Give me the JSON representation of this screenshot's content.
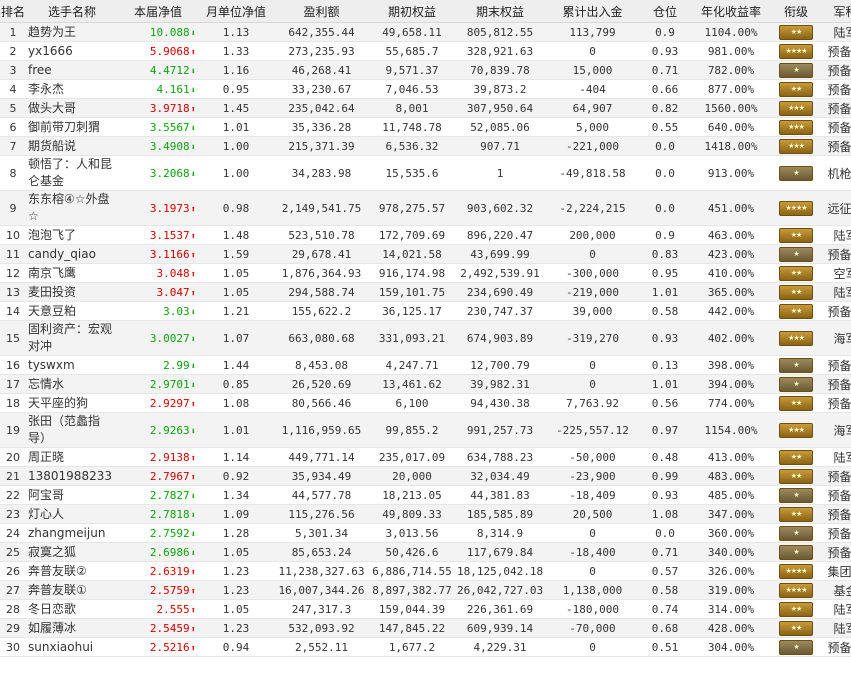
{
  "headers": [
    "排名",
    "选手名称",
    "本届净值",
    "月单位净值",
    "盈利额",
    "期初权益",
    "期末权益",
    "累计出入金",
    "仓位",
    "年化收益率",
    "衔级",
    "军种"
  ],
  "rows": [
    {
      "rank": "1",
      "name": "趋势为王",
      "nav": "10.088",
      "dir": "down",
      "mnav": "1.13",
      "profit": "642,355.44",
      "start": "49,658.11",
      "end": "805,812.55",
      "flow": "113,799",
      "pos": "0.9",
      "annual": "1104.00%",
      "badge": "★★",
      "army": "陆军"
    },
    {
      "rank": "2",
      "name": "yx1666",
      "nav": "5.9068",
      "dir": "up",
      "mnav": "1.33",
      "profit": "273,235.93",
      "start": "55,685.7",
      "end": "328,921.63",
      "flow": "0",
      "pos": "0.93",
      "annual": "981.00%",
      "badge": "★★★★",
      "army": "预备役"
    },
    {
      "rank": "3",
      "name": "free",
      "nav": "4.4712",
      "dir": "down",
      "mnav": "1.16",
      "profit": "46,268.41",
      "start": "9,571.37",
      "end": "70,839.78",
      "flow": "15,000",
      "pos": "0.71",
      "annual": "782.00%",
      "badge": "★",
      "army": "预备役"
    },
    {
      "rank": "4",
      "name": "李永杰",
      "nav": "4.161",
      "dir": "down",
      "mnav": "0.95",
      "profit": "33,230.67",
      "start": "7,046.53",
      "end": "39,873.2",
      "flow": "-404",
      "pos": "0.66",
      "annual": "877.00%",
      "badge": "★★",
      "army": "预备役"
    },
    {
      "rank": "5",
      "name": "做头大哥",
      "nav": "3.9718",
      "dir": "up",
      "mnav": "1.45",
      "profit": "235,042.64",
      "start": "8,001",
      "end": "307,950.64",
      "flow": "64,907",
      "pos": "0.82",
      "annual": "1560.00%",
      "badge": "★★★",
      "army": "预备役"
    },
    {
      "rank": "6",
      "name": "御前带刀刺猬",
      "nav": "3.5567",
      "dir": "down",
      "mnav": "1.01",
      "profit": "35,336.28",
      "start": "11,748.78",
      "end": "52,085.06",
      "flow": "5,000",
      "pos": "0.55",
      "annual": "640.00%",
      "badge": "★★★",
      "army": "预备役"
    },
    {
      "rank": "7",
      "name": "期货船说",
      "nav": "3.4908",
      "dir": "down",
      "mnav": "1.00",
      "profit": "215,371.39",
      "start": "6,536.32",
      "end": "907.71",
      "flow": "-221,000",
      "pos": "0.0",
      "annual": "1418.00%",
      "badge": "★★★",
      "army": "预备役"
    },
    {
      "rank": "8",
      "name": "顿悟了：人和昆仑基金",
      "nav": "3.2068",
      "dir": "down",
      "mnav": "1.00",
      "profit": "34,283.98",
      "start": "15,535.6",
      "end": "1",
      "flow": "-49,818.58",
      "pos": "0.0",
      "annual": "913.00%",
      "badge": "★",
      "army": "机枪手"
    },
    {
      "rank": "9",
      "name": "东东榕④☆外盘☆",
      "nav": "3.1973",
      "dir": "up",
      "mnav": "0.98",
      "profit": "2,149,541.75",
      "start": "978,275.57",
      "end": "903,602.32",
      "flow": "-2,224,215",
      "pos": "0.0",
      "annual": "451.00%",
      "badge": "★★★★",
      "army": "远征军"
    },
    {
      "rank": "10",
      "name": "泡泡飞了",
      "nav": "3.1537",
      "dir": "up",
      "mnav": "1.48",
      "profit": "523,510.78",
      "start": "172,709.69",
      "end": "896,220.47",
      "flow": "200,000",
      "pos": "0.9",
      "annual": "463.00%",
      "badge": "★★",
      "army": "陆军"
    },
    {
      "rank": "11",
      "name": "candy_qiao",
      "nav": "3.1166",
      "dir": "up",
      "mnav": "1.59",
      "profit": "29,678.41",
      "start": "14,021.58",
      "end": "43,699.99",
      "flow": "0",
      "pos": "0.83",
      "annual": "423.00%",
      "badge": "★",
      "army": "预备役"
    },
    {
      "rank": "12",
      "name": "南京飞鹰",
      "nav": "3.048",
      "dir": "up",
      "mnav": "1.05",
      "profit": "1,876,364.93",
      "start": "916,174.98",
      "end": "2,492,539.91",
      "flow": "-300,000",
      "pos": "0.95",
      "annual": "410.00%",
      "badge": "★★",
      "army": "空军"
    },
    {
      "rank": "13",
      "name": "麦田投资",
      "nav": "3.047",
      "dir": "up",
      "mnav": "1.05",
      "profit": "294,588.74",
      "start": "159,101.75",
      "end": "234,690.49",
      "flow": "-219,000",
      "pos": "1.01",
      "annual": "365.00%",
      "badge": "★★",
      "army": "陆军"
    },
    {
      "rank": "14",
      "name": "天意豆粕",
      "nav": "3.03",
      "dir": "down",
      "mnav": "1.21",
      "profit": "155,622.2",
      "start": "36,125.17",
      "end": "230,747.37",
      "flow": "39,000",
      "pos": "0.58",
      "annual": "442.00%",
      "badge": "★★",
      "army": "预备役"
    },
    {
      "rank": "15",
      "name": "固利资产：宏观对冲",
      "nav": "3.0027",
      "dir": "down",
      "mnav": "1.07",
      "profit": "663,080.68",
      "start": "331,093.21",
      "end": "674,903.89",
      "flow": "-319,270",
      "pos": "0.93",
      "annual": "402.00%",
      "badge": "★★★",
      "army": "海军"
    },
    {
      "rank": "16",
      "name": "tyswxm",
      "nav": "2.99",
      "dir": "down",
      "mnav": "1.44",
      "profit": "8,453.08",
      "start": "4,247.71",
      "end": "12,700.79",
      "flow": "0",
      "pos": "0.13",
      "annual": "398.00%",
      "badge": "★",
      "army": "预备役"
    },
    {
      "rank": "17",
      "name": "忘情水",
      "nav": "2.9701",
      "dir": "down",
      "mnav": "0.85",
      "profit": "26,520.69",
      "start": "13,461.62",
      "end": "39,982.31",
      "flow": "0",
      "pos": "1.01",
      "annual": "394.00%",
      "badge": "★",
      "army": "预备役"
    },
    {
      "rank": "18",
      "name": "天平座的狗",
      "nav": "2.9297",
      "dir": "up",
      "mnav": "1.08",
      "profit": "80,566.46",
      "start": "6,100",
      "end": "94,430.38",
      "flow": "7,763.92",
      "pos": "0.56",
      "annual": "774.00%",
      "badge": "★★",
      "army": "预备役"
    },
    {
      "rank": "19",
      "name": "张田（范蠡指导）",
      "nav": "2.9263",
      "dir": "down",
      "mnav": "1.01",
      "profit": "1,116,959.65",
      "start": "99,855.2",
      "end": "991,257.73",
      "flow": "-225,557.12",
      "pos": "0.97",
      "annual": "1154.00%",
      "badge": "★★★",
      "army": "海军"
    },
    {
      "rank": "20",
      "name": "周正晓",
      "nav": "2.9138",
      "dir": "up",
      "mnav": "1.14",
      "profit": "449,771.14",
      "start": "235,017.09",
      "end": "634,788.23",
      "flow": "-50,000",
      "pos": "0.48",
      "annual": "413.00%",
      "badge": "★★",
      "army": "陆军"
    },
    {
      "rank": "21",
      "name": "13801988233",
      "nav": "2.7967",
      "dir": "up",
      "mnav": "0.92",
      "profit": "35,934.49",
      "start": "20,000",
      "end": "32,034.49",
      "flow": "-23,900",
      "pos": "0.99",
      "annual": "483.00%",
      "badge": "★★",
      "army": "预备役"
    },
    {
      "rank": "22",
      "name": "阿宝哥",
      "nav": "2.7827",
      "dir": "down",
      "mnav": "1.34",
      "profit": "44,577.78",
      "start": "18,213.05",
      "end": "44,381.83",
      "flow": "-18,409",
      "pos": "0.93",
      "annual": "485.00%",
      "badge": "★",
      "army": "预备役"
    },
    {
      "rank": "23",
      "name": "灯心人",
      "nav": "2.7818",
      "dir": "down",
      "mnav": "1.09",
      "profit": "115,276.56",
      "start": "49,809.33",
      "end": "185,585.89",
      "flow": "20,500",
      "pos": "1.08",
      "annual": "347.00%",
      "badge": "★★",
      "army": "预备役"
    },
    {
      "rank": "24",
      "name": "zhangmeijun",
      "nav": "2.7592",
      "dir": "down",
      "mnav": "1.28",
      "profit": "5,301.34",
      "start": "3,013.56",
      "end": "8,314.9",
      "flow": "0",
      "pos": "0.0",
      "annual": "360.00%",
      "badge": "★",
      "army": "预备役"
    },
    {
      "rank": "25",
      "name": "寂寞之狐",
      "nav": "2.6986",
      "dir": "down",
      "mnav": "1.05",
      "profit": "85,653.24",
      "start": "50,426.6",
      "end": "117,679.84",
      "flow": "-18,400",
      "pos": "0.71",
      "annual": "340.00%",
      "badge": "★",
      "army": "预备役"
    },
    {
      "rank": "26",
      "name": "奔普友联②",
      "nav": "2.6319",
      "dir": "up",
      "mnav": "1.23",
      "profit": "11,238,327.63",
      "start": "6,886,714.55",
      "end": "18,125,042.18",
      "flow": "0",
      "pos": "0.57",
      "annual": "326.00%",
      "badge": "★★★★",
      "army": "集团军"
    },
    {
      "rank": "27",
      "name": "奔普友联①",
      "nav": "2.5759",
      "dir": "up",
      "mnav": "1.23",
      "profit": "16,007,344.26",
      "start": "8,897,382.77",
      "end": "26,042,727.03",
      "flow": "1,138,000",
      "pos": "0.58",
      "annual": "319.00%",
      "badge": "★★★★",
      "army": "基金"
    },
    {
      "rank": "28",
      "name": "冬日恋歌",
      "nav": "2.555",
      "dir": "up",
      "mnav": "1.05",
      "profit": "247,317.3",
      "start": "159,044.39",
      "end": "226,361.69",
      "flow": "-180,000",
      "pos": "0.74",
      "annual": "314.00%",
      "badge": "★★",
      "army": "陆军"
    },
    {
      "rank": "29",
      "name": "如履薄冰",
      "nav": "2.5459",
      "dir": "up",
      "mnav": "1.23",
      "profit": "532,093.92",
      "start": "147,845.22",
      "end": "609,939.14",
      "flow": "-70,000",
      "pos": "0.68",
      "annual": "428.00%",
      "badge": "★★",
      "army": "陆军"
    },
    {
      "rank": "30",
      "name": "sunxiaohui",
      "nav": "2.5216",
      "dir": "up",
      "mnav": "0.94",
      "profit": "2,552.11",
      "start": "1,677.2",
      "end": "4,229.31",
      "flow": "0",
      "pos": "0.51",
      "annual": "304.00%",
      "badge": "★",
      "army": "预备役"
    }
  ]
}
